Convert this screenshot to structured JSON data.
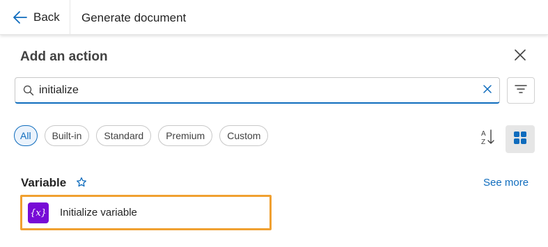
{
  "header": {
    "back_label": "Back",
    "document_title": "Generate document",
    "back_icon": "arrow-left-icon"
  },
  "panel": {
    "title": "Add an action",
    "close_icon": "close-icon"
  },
  "search": {
    "value": "initialize",
    "placeholder": "",
    "search_icon": "search-icon",
    "clear_icon": "clear-icon",
    "filter_icon": "filter-icon"
  },
  "filters": {
    "chips": [
      {
        "label": "All",
        "active": true
      },
      {
        "label": "Built-in",
        "active": false
      },
      {
        "label": "Standard",
        "active": false
      },
      {
        "label": "Premium",
        "active": false
      },
      {
        "label": "Custom",
        "active": false
      }
    ],
    "sort_icon": "sort-az-icon",
    "view_icon": "grid-view-icon"
  },
  "section": {
    "title": "Variable",
    "favorite_icon": "star-icon",
    "see_more_label": "See more",
    "items": [
      {
        "label": "Initialize variable",
        "icon_text": "{x}",
        "icon_color": "#770bd6"
      }
    ]
  },
  "colors": {
    "accent": "#0f6cbd",
    "highlight_border": "#f0a030",
    "variable_icon_bg": "#770bd6"
  }
}
